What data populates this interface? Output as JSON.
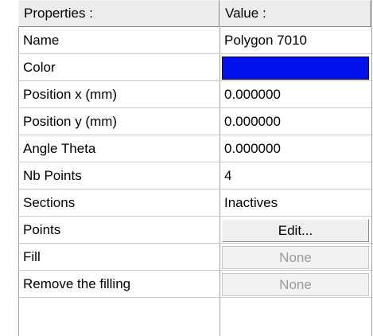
{
  "header": {
    "properties_label": "Properties :",
    "value_label": "Value :"
  },
  "rows": [
    {
      "label": "Name",
      "value": "Polygon 7010"
    },
    {
      "label": "Color",
      "value_color": "#0011ee"
    },
    {
      "label": "Position x (mm)",
      "value": "0.000000"
    },
    {
      "label": "Position y (mm)",
      "value": "0.000000"
    },
    {
      "label": "Angle Theta",
      "value": "0.000000"
    },
    {
      "label": "Nb Points",
      "value": "4"
    },
    {
      "label": "Sections",
      "value": "Inactives"
    },
    {
      "label": "Points",
      "button": "Edit..."
    },
    {
      "label": "Fill",
      "button": "None",
      "disabled": true
    },
    {
      "label": "Remove the filling",
      "button": "None",
      "disabled": true
    }
  ]
}
